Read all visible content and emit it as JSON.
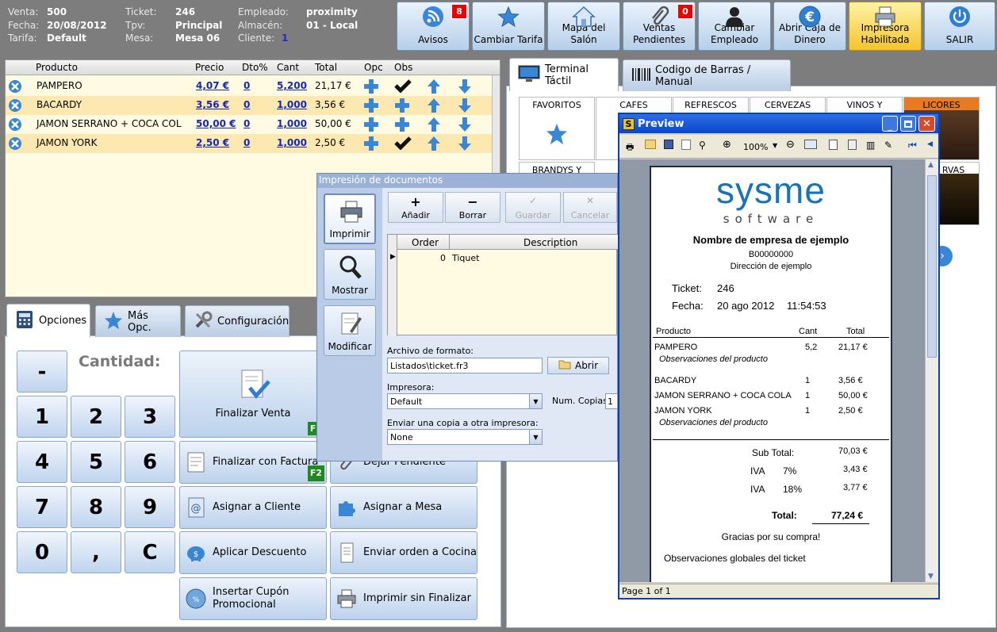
{
  "header": {
    "fields": [
      {
        "label": "Venta:",
        "value": "500"
      },
      {
        "label": "Fecha:",
        "value": "20/08/2012"
      },
      {
        "label": "Tarifa:",
        "value": "Default"
      },
      {
        "label": "Ticket:",
        "value": "246"
      },
      {
        "label": "Tpv:",
        "value": "Principal"
      },
      {
        "label": "Mesa:",
        "value": "Mesa 06"
      },
      {
        "label": "Empleado:",
        "value": "proximity"
      },
      {
        "label": "Almacén:",
        "value": "01 - Local"
      },
      {
        "label": "Cliente:",
        "value": "1"
      }
    ],
    "buttons": [
      {
        "label": "Avisos",
        "badge": "8",
        "icon": "rss-icon"
      },
      {
        "label": "Cambiar Tarifa",
        "icon": "star-icon"
      },
      {
        "label": "Mapa del Salón",
        "icon": "house-icon"
      },
      {
        "label": "Ventas Pendientes",
        "badge": "0",
        "icon": "paperclip-icon"
      },
      {
        "label": "Cambiar Empleado",
        "icon": "user-icon"
      },
      {
        "label": "Abrir Caja de Dinero",
        "icon": "euro-icon"
      },
      {
        "label": "Impresora Habilitada",
        "icon": "printer-icon"
      },
      {
        "label": "SALIR",
        "icon": "power-icon"
      }
    ]
  },
  "order": {
    "columns": [
      "Producto",
      "Precio",
      "Dto%",
      "Cant",
      "Total",
      "Opc",
      "Obs"
    ],
    "rows": [
      {
        "product": "PAMPERO",
        "price": "4,07 €",
        "dto": "0",
        "qty": "5,200",
        "total": "21,17 €",
        "obs": "check"
      },
      {
        "product": "BACARDY",
        "price": "3,56 €",
        "dto": "0",
        "qty": "1,000",
        "total": "3,56 €",
        "obs": "plus"
      },
      {
        "product": "JAMON SERRANO + COCA COL",
        "price": "50,00 €",
        "dto": "0",
        "qty": "1,000",
        "total": "50,00 €",
        "obs": "plus"
      },
      {
        "product": "JAMON YORK",
        "price": "2,50 €",
        "dto": "0",
        "qty": "1,000",
        "total": "2,50 €",
        "obs": "check"
      }
    ]
  },
  "left_tabs": [
    "Opciones",
    "Más Opc.",
    "Configuración"
  ],
  "keypad": {
    "label": "Cantidad:",
    "keys": [
      "-",
      "1",
      "2",
      "3",
      "4",
      "5",
      "6",
      "7",
      "8",
      "9",
      "0",
      ",",
      "C"
    ]
  },
  "actions": {
    "finalizar_venta": "Finalizar Venta",
    "f1": "F1",
    "finalizar_factura": "Finalizar con Factura",
    "f2": "F2",
    "dejar_pendiente": "Dejar Pendiente",
    "asignar_cliente": "Asignar a Cliente",
    "asignar_mesa": "Asignar a Mesa",
    "aplicar_descuento": "Aplicar Descuento",
    "enviar_cocina": "Enviar orden a Cocina",
    "insertar_cupon": "Insertar Cupón Promocional",
    "imprimir_sin": "Imprimir sin Finalizar"
  },
  "right_tabs": [
    "Terminal Táctil",
    "Codigo de Barras / Manual"
  ],
  "categories": [
    "FAVORITOS",
    "CAFES",
    "REFRESCOS",
    "CERVEZAS",
    "VINOS Y",
    "LICORES",
    "BRANDYS Y",
    "RVAS"
  ],
  "print_dialog": {
    "title": "Impresión de documentos",
    "side": [
      "Imprimir",
      "Mostrar",
      "Modificar"
    ],
    "toolbar": [
      "Añadir",
      "Borrar",
      "Guardar",
      "Cancelar"
    ],
    "grid_headers": [
      "Order",
      "Description"
    ],
    "grid_row": {
      "order": "0",
      "description": "Tiquet"
    },
    "format_label": "Archivo de formato:",
    "format_value": "Listados\\ticket.fr3",
    "open": "Abrir",
    "printer_label": "Impresora:",
    "printer_value": "Default",
    "copies_label": "Num. Copias:",
    "copies_value": "1",
    "copy_label": "Enviar una copia a otra impresora:",
    "copy_value": "None"
  },
  "preview": {
    "title": "Preview",
    "zoom": "100%",
    "status": "Page 1 of 1",
    "logo_top": "sysme",
    "logo_bottom": "software",
    "company": "Nombre de empresa de ejemplo",
    "cif": "B00000000",
    "address": "Dirección de ejemplo",
    "ticket_label": "Ticket:",
    "ticket": "246",
    "fecha_label": "Fecha:",
    "fecha": "20 ago 2012",
    "hora": "11:54:53",
    "cols": [
      "Producto",
      "Cant",
      "Total"
    ],
    "lines": [
      {
        "p": "PAMPERO",
        "c": "5,2",
        "t": "21,17 €",
        "obs": "Observaciones del producto"
      },
      {
        "p": "BACARDY",
        "c": "1",
        "t": "3,56 €",
        "obs": ""
      },
      {
        "p": "JAMON SERRANO + COCA COLA",
        "c": "1",
        "t": "50,00 €",
        "obs": ""
      },
      {
        "p": "JAMON YORK",
        "c": "1",
        "t": "2,50 €",
        "obs": "Observaciones del producto"
      }
    ],
    "subtotal_label": "Sub Total:",
    "subtotal": "70,03 €",
    "iva1_label": "IVA",
    "iva1_rate": "7%",
    "iva1": "3,43 €",
    "iva2_label": "IVA",
    "iva2_rate": "18%",
    "iva2": "3,77 €",
    "total_label": "Total:",
    "total": "77,24 €",
    "thanks": "Gracias por su compra!",
    "global_obs": "Observaciones globales del ticket"
  }
}
